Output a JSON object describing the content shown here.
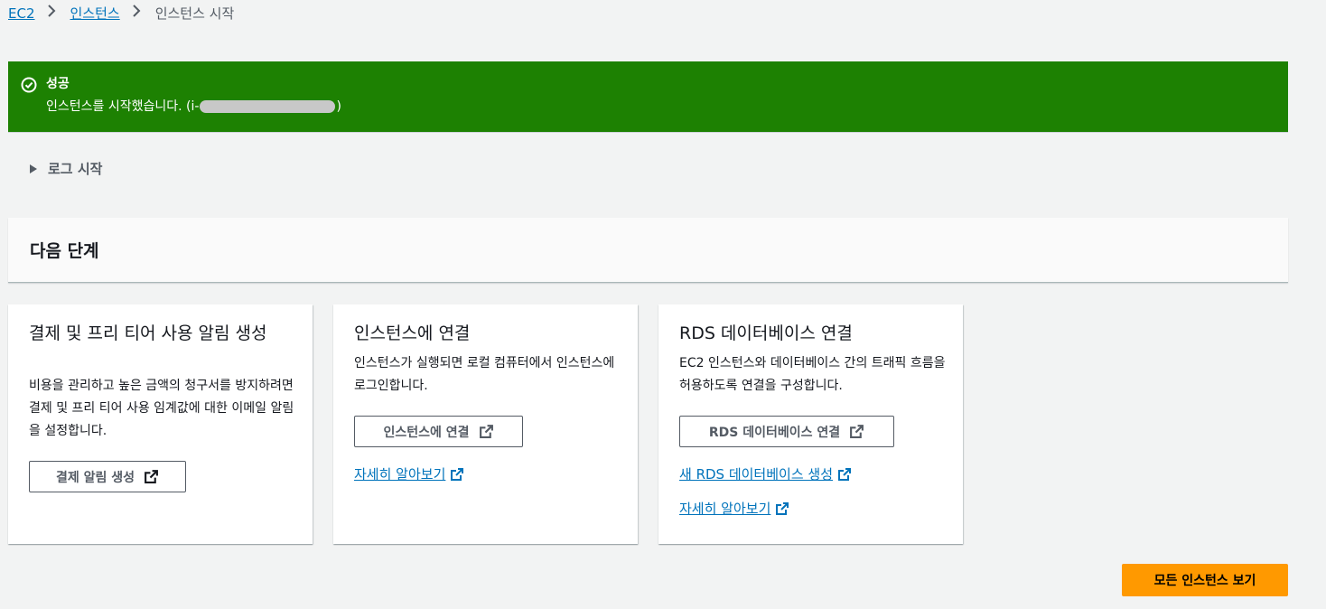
{
  "breadcrumb": {
    "items": [
      "EC2",
      "인스턴스"
    ],
    "current": "인스턴스 시작"
  },
  "flash": {
    "title": "성공",
    "message_prefix": "인스턴스를 시작했습니다. (i-",
    "message_suffix": ")",
    "icon": "success-circle-icon",
    "color": "#1d8102"
  },
  "log": {
    "label": "로그 시작"
  },
  "next_steps": {
    "title": "다음 단계"
  },
  "cards": [
    {
      "title": "결제 및 프리 티어 사용 알림 생성",
      "description": "비용을 관리하고 높은 금액의 청구서를 방지하려면 결제 및 프리 티어 사용 임계값에 대한 이메일 알림을 설정합니다.",
      "button": "결제 알림 생성"
    },
    {
      "title": "인스턴스에 연결",
      "description": "인스턴스가 실행되면 로컬 컴퓨터에서 인스턴스에 로그인합니다.",
      "button": "인스턴스에 연결",
      "link": "자세히 알아보기"
    },
    {
      "title": "RDS 데이터베이스 연결",
      "description": "EC2 인스턴스와 데이터베이스 간의 트래픽 흐름을 허용하도록 연결을 구성합니다.",
      "button": "RDS 데이터베이스 연결",
      "links": [
        "새 RDS 데이터베이스 생성",
        "자세히 알아보기"
      ]
    }
  ],
  "primary_button": {
    "label": "모든 인스턴스 보기",
    "color": "#ff9900"
  }
}
